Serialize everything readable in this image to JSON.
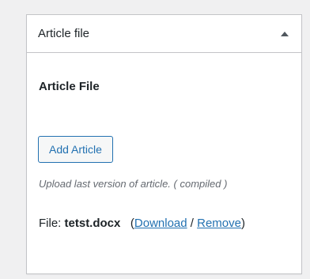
{
  "metabox": {
    "title": "Article file",
    "toggle_icon": "triangle-up-icon"
  },
  "content": {
    "section_title": "Article File",
    "add_button_label": "Add Article",
    "help_text": "Upload last version of article. ( compiled )",
    "file_prefix": "File:",
    "file_name": "tetst.docx",
    "open_paren": "(",
    "download_label": "Download",
    "separator": "/",
    "remove_label": "Remove",
    "close_paren": ")"
  },
  "colors": {
    "link": "#2271b1",
    "border": "#c3c4c7",
    "background": "#f0f0f1"
  }
}
